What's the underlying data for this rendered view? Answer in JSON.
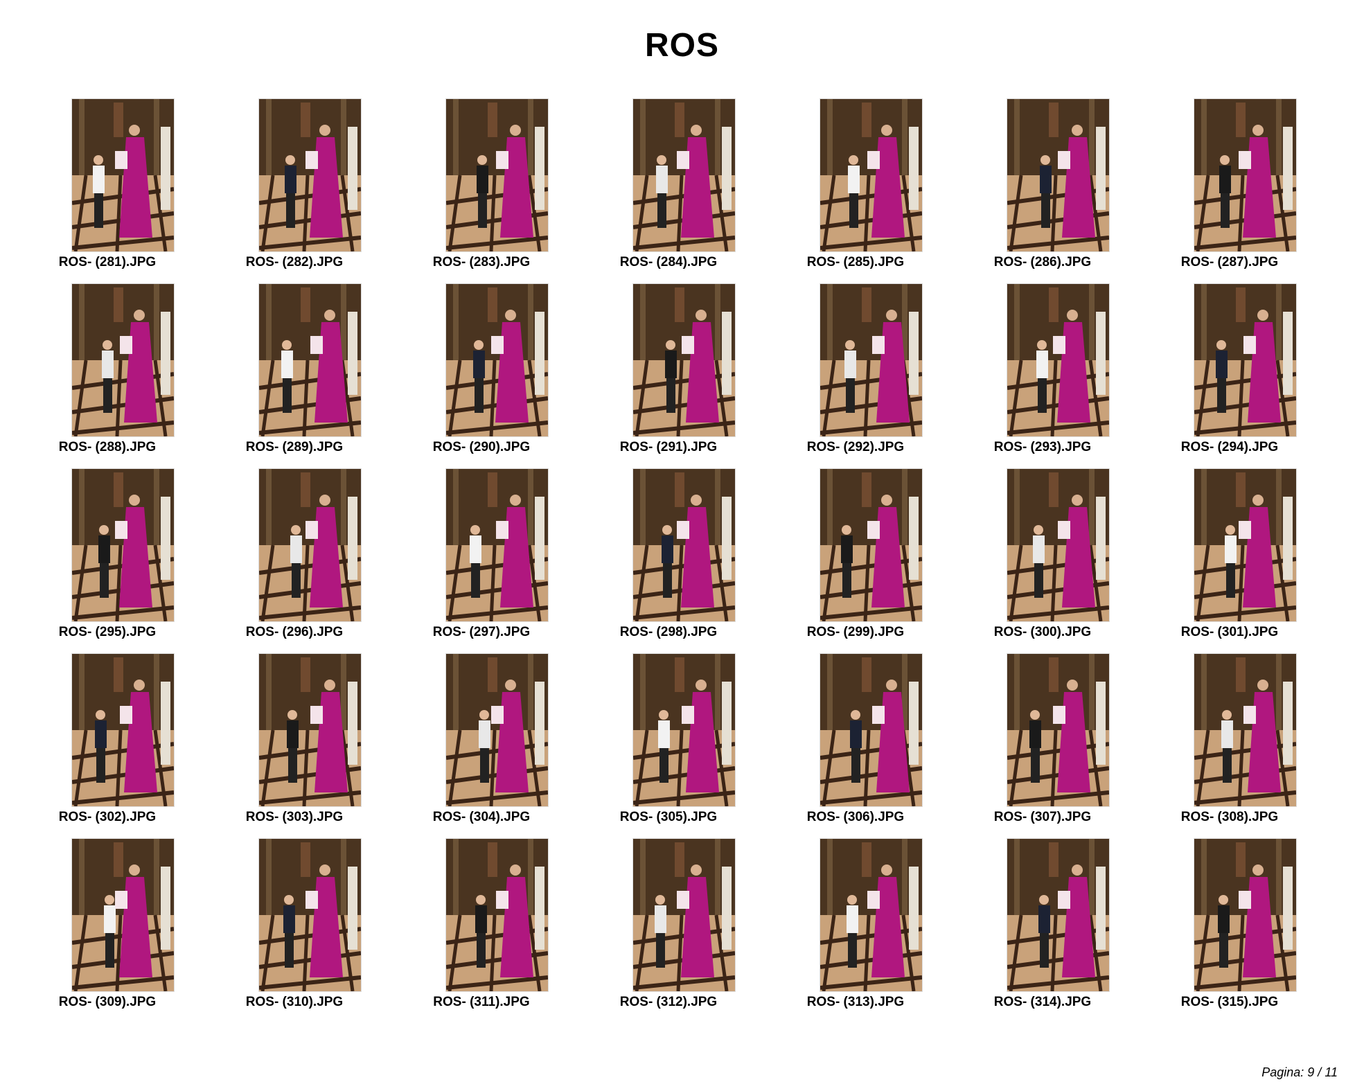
{
  "title": "ROS",
  "footer": "Pagina: 9 / 11",
  "thumbnails": [
    {
      "filename": "ROS- (281).JPG"
    },
    {
      "filename": "ROS- (282).JPG"
    },
    {
      "filename": "ROS- (283).JPG"
    },
    {
      "filename": "ROS- (284).JPG"
    },
    {
      "filename": "ROS- (285).JPG"
    },
    {
      "filename": "ROS- (286).JPG"
    },
    {
      "filename": "ROS- (287).JPG"
    },
    {
      "filename": "ROS- (288).JPG"
    },
    {
      "filename": "ROS- (289).JPG"
    },
    {
      "filename": "ROS- (290).JPG"
    },
    {
      "filename": "ROS- (291).JPG"
    },
    {
      "filename": "ROS- (292).JPG"
    },
    {
      "filename": "ROS- (293).JPG"
    },
    {
      "filename": "ROS- (294).JPG"
    },
    {
      "filename": "ROS- (295).JPG"
    },
    {
      "filename": "ROS- (296).JPG"
    },
    {
      "filename": "ROS- (297).JPG"
    },
    {
      "filename": "ROS- (298).JPG"
    },
    {
      "filename": "ROS- (299).JPG"
    },
    {
      "filename": "ROS- (300).JPG"
    },
    {
      "filename": "ROS- (301).JPG"
    },
    {
      "filename": "ROS- (302).JPG"
    },
    {
      "filename": "ROS- (303).JPG"
    },
    {
      "filename": "ROS- (304).JPG"
    },
    {
      "filename": "ROS- (305).JPG"
    },
    {
      "filename": "ROS- (306).JPG"
    },
    {
      "filename": "ROS- (307).JPG"
    },
    {
      "filename": "ROS- (308).JPG"
    },
    {
      "filename": "ROS- (309).JPG"
    },
    {
      "filename": "ROS- (310).JPG"
    },
    {
      "filename": "ROS- (311).JPG"
    },
    {
      "filename": "ROS- (312).JPG"
    },
    {
      "filename": "ROS- (313).JPG"
    },
    {
      "filename": "ROS- (314).JPG"
    },
    {
      "filename": "ROS- (315).JPG"
    }
  ],
  "colors": {
    "vestment": "#b0177f",
    "floor_light": "#c9a27a",
    "floor_dark": "#3b2416",
    "wall": "#4a3420"
  }
}
